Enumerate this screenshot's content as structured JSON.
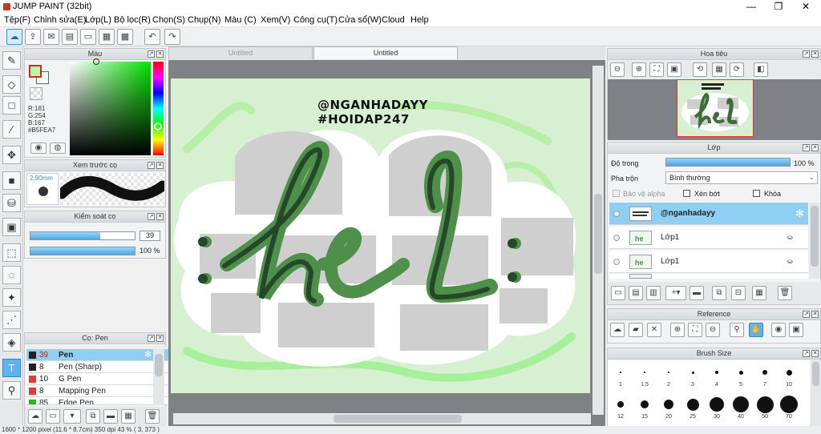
{
  "window": {
    "title": "JUMP PAINT (32bit)",
    "controls": [
      "—",
      "❐",
      "✕"
    ]
  },
  "menu": [
    "Tệp(F)",
    "Chỉnh sửa(E)",
    "Lớp(L)",
    "Bộ lọc(R)",
    "Chọn(S)",
    "Chụp(N)",
    "Màu (C)",
    "Xem(V)",
    "Công cụ(T)",
    "Cửa sổ(W)",
    "Cloud",
    "Help"
  ],
  "tabs": [
    {
      "label": "Untitled",
      "active": false
    },
    {
      "label": "Untitled",
      "active": true
    }
  ],
  "color_panel": {
    "title": "Màu",
    "r": "R:181",
    "g": "G:254",
    "b": "B:167",
    "hex": "#B5FEA7",
    "current_color": "#b5fea7"
  },
  "preview_panel": {
    "title": "Xem trước cọ",
    "size": "2.90mm"
  },
  "brush_control": {
    "title": "Kiểm soát cọ",
    "size_value": "39",
    "size_fraction": 0.67,
    "opacity_value": "100 %",
    "opacity_fraction": 1.0
  },
  "brush_list": {
    "title": "Cọ: Pen",
    "items": [
      {
        "num": "39",
        "label": "Pen",
        "color": "#222222",
        "selected": true
      },
      {
        "num": "8",
        "label": "Pen (Sharp)",
        "color": "#222222",
        "selected": false
      },
      {
        "num": "10",
        "label": "G Pen",
        "color": "#e23b3b",
        "selected": false
      },
      {
        "num": "8",
        "label": "Mapping Pen",
        "color": "#e23b3b",
        "selected": false
      },
      {
        "num": "85",
        "label": "Edge Pen",
        "color": "#2ab52a",
        "selected": false
      }
    ]
  },
  "artwork": {
    "line1": "@NGANHADAYY",
    "line2": "#HOIDAP247",
    "main": "hel",
    "green": "#4e8f4a",
    "dark_green": "#26482a"
  },
  "navigator": {
    "title": "Hoa tiêu"
  },
  "layers": {
    "title": "Lớp",
    "opacity_label": "Độ trong",
    "opacity_value": "100 %",
    "opacity_fraction": 1.0,
    "blend_label": "Pha trộn",
    "blend_value": "Bình thường",
    "protect_alpha": "Bảo vệ alpha",
    "clipping": "Xén bớt",
    "lock": "Khóa",
    "rows": [
      {
        "name": "@nganhadayy",
        "selected": true
      },
      {
        "name": "Lớp1",
        "selected": false
      },
      {
        "name": "Lớp1",
        "selected": false
      }
    ]
  },
  "reference": {
    "title": "Reference"
  },
  "brush_size": {
    "title": "Brush Size",
    "row1": [
      "1",
      "1.5",
      "2",
      "3",
      "4",
      "5",
      "7",
      "10"
    ],
    "row2": [
      "12",
      "15",
      "20",
      "25",
      "30",
      "40",
      "50",
      "70"
    ]
  },
  "status": {
    "text": "1600 * 1200 pixel  (11.6 * 8.7cm)  350 dpi  43 %  ( 3, 373 )"
  }
}
